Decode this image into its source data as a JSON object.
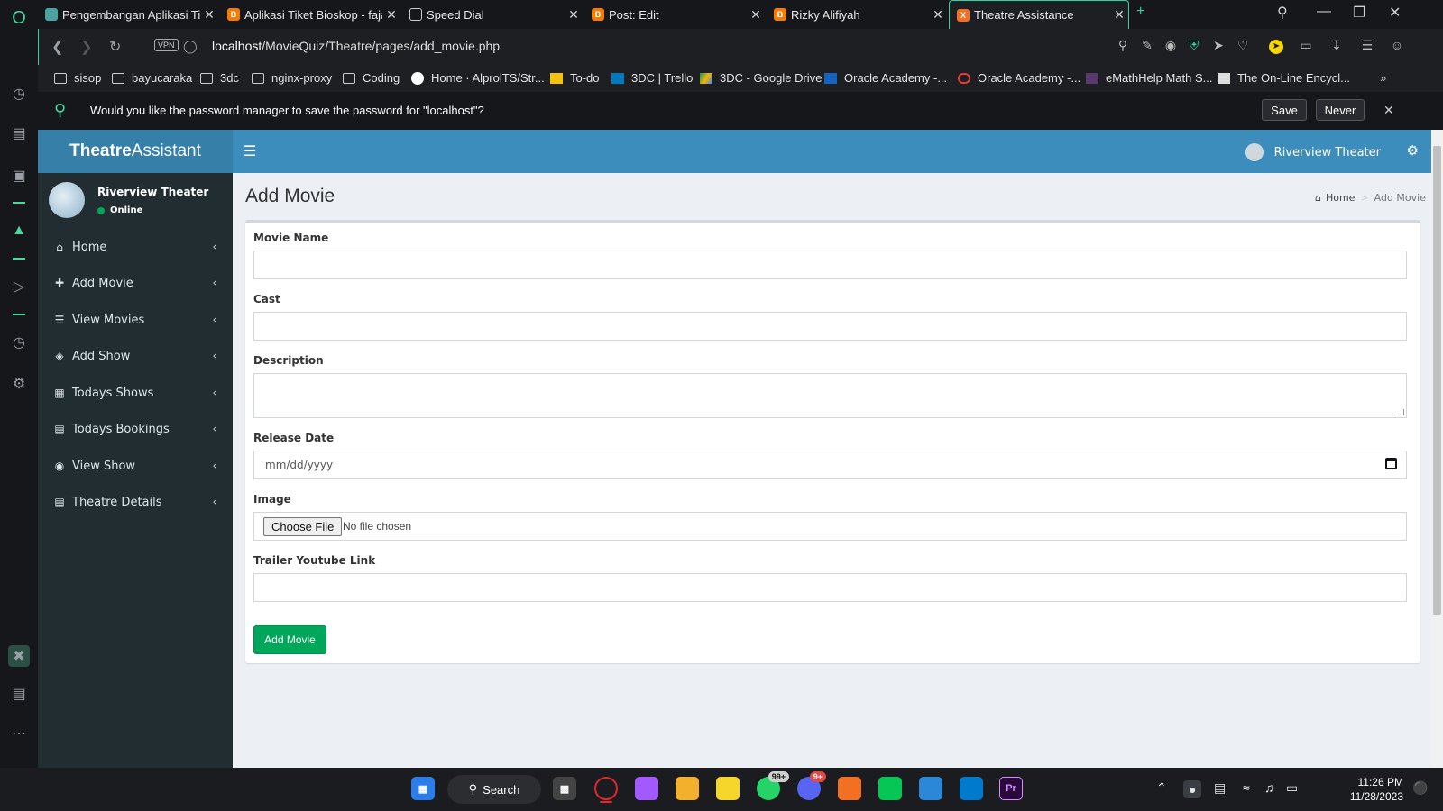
{
  "browser": {
    "tabs": [
      {
        "label": "Pengembangan Aplikasi Tik",
        "color": "#4aa3a0",
        "active": false
      },
      {
        "label": "Aplikasi Tiket Bioskop - faja",
        "color": "#f57c00",
        "active": false
      },
      {
        "label": "Speed Dial",
        "color": "",
        "active": false
      },
      {
        "label": "Post: Edit",
        "color": "#f57c00",
        "active": false
      },
      {
        "label": "Rizky Alifiyah",
        "color": "#f57c00",
        "active": false
      },
      {
        "label": "Theatre Assistance",
        "color": "#f36f21",
        "active": true
      }
    ],
    "new_tab": "+",
    "url_host": "localhost",
    "url_path": "/MovieQuiz/Theatre/pages/add_movie.php",
    "vpn_label": "VPN",
    "bookmarks": [
      {
        "label": "sisop",
        "icon": "folder-icon"
      },
      {
        "label": "bayucaraka",
        "icon": "folder-icon"
      },
      {
        "label": "3dc",
        "icon": "folder-icon"
      },
      {
        "label": "nginx-proxy",
        "icon": "folder-icon"
      },
      {
        "label": "Coding",
        "icon": "folder-icon"
      },
      {
        "label": "Home · AlprolTS/Str...",
        "icon": "github-icon"
      },
      {
        "label": "To-do",
        "icon": "todo-icon"
      },
      {
        "label": "3DC | Trello",
        "icon": "trello-icon"
      },
      {
        "label": "3DC - Google Drive",
        "icon": "drive-icon"
      },
      {
        "label": "Oracle Academy -...",
        "icon": "oracle-blue-icon"
      },
      {
        "label": "Oracle Academy -...",
        "icon": "oracle-red-icon"
      },
      {
        "label": "eMathHelp Math S...",
        "icon": "emathhelp-icon"
      },
      {
        "label": "The On-Line Encycl...",
        "icon": "oeis-icon"
      }
    ],
    "password_prompt": {
      "message": "Would you like the password manager to save the password for \"localhost\"?",
      "save_label": "Save",
      "never_label": "Never"
    }
  },
  "app": {
    "logo_bold": "Theatre",
    "logo_rest": " Assistant",
    "header_user": "Riverview Theater",
    "sidebar_user": {
      "name": "Riverview Theater",
      "status": "Online"
    },
    "menu": [
      {
        "label": "Home",
        "icon": "home-icon",
        "glyph": "⌂"
      },
      {
        "label": "Add Movie",
        "icon": "plus-icon",
        "glyph": "✚"
      },
      {
        "label": "View Movies",
        "icon": "list-icon",
        "glyph": "☰"
      },
      {
        "label": "Add Show",
        "icon": "ticket-icon",
        "glyph": "◈"
      },
      {
        "label": "Todays Shows",
        "icon": "calendar-icon",
        "glyph": "▦"
      },
      {
        "label": "Todays Bookings",
        "icon": "film-icon",
        "glyph": "▤"
      },
      {
        "label": "View Show",
        "icon": "eye-icon",
        "glyph": "◉"
      },
      {
        "label": "Theatre Details",
        "icon": "film-icon",
        "glyph": "▤"
      }
    ],
    "page_title": "Add Movie",
    "breadcrumb": {
      "home": "Home",
      "current": "Add Movie"
    },
    "form": {
      "movie_name_label": "Movie Name",
      "movie_name_value": "",
      "cast_label": "Cast",
      "cast_value": "",
      "description_label": "Description",
      "description_value": "",
      "release_date_label": "Release Date",
      "release_date_placeholder": "mm/dd/yyyy",
      "image_label": "Image",
      "choose_file_label": "Choose File",
      "no_file_text": "No file chosen",
      "trailer_label": "Trailer Youtube Link",
      "trailer_value": "",
      "submit_label": "Add Movie"
    },
    "colors": {
      "header": "#3c8dbc",
      "logo_bg": "#367fa9",
      "sidebar": "#222d32",
      "submit": "#00a65a",
      "online": "#00a65a"
    }
  },
  "taskbar": {
    "search_label": "Search",
    "whatsapp_badge": "99+",
    "discord_badge": "9+",
    "time": "11:26 PM",
    "date": "11/28/2023"
  }
}
